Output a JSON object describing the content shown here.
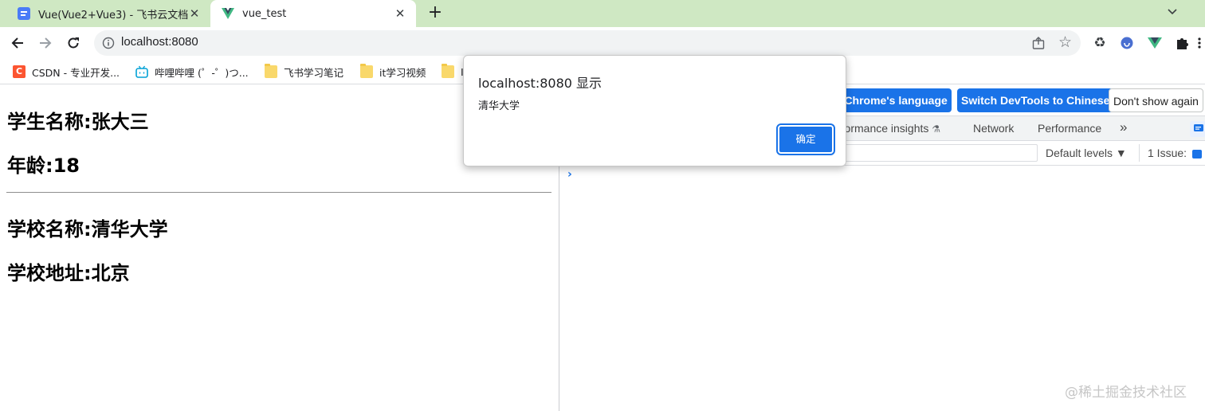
{
  "tabs": [
    {
      "title": "Vue(Vue2+Vue3) - 飞书云文档",
      "icon": "feishu-doc-icon"
    },
    {
      "title": "vue_test",
      "icon": "vue-logo-icon"
    }
  ],
  "address_bar": {
    "url": "localhost:8080"
  },
  "bookmarks": [
    {
      "label": "CSDN - 专业开发...",
      "icon": "csdn-icon"
    },
    {
      "label": "哔哩哔哩 (゜-゜)つ...",
      "icon": "bilibili-icon"
    },
    {
      "label": "飞书学习笔记",
      "icon": "folder-icon"
    },
    {
      "label": "it学习视频",
      "icon": "folder-icon"
    },
    {
      "label": "I",
      "icon": "folder-icon"
    }
  ],
  "page": {
    "student_name": "学生名称:张大三",
    "age": "年龄:18",
    "school_name": "学校名称:清华大学",
    "school_address": "学校地址:北京"
  },
  "devtools": {
    "infobar": {
      "match_language": "n Chrome's language",
      "switch_chinese": "Switch DevTools to Chinese",
      "dont_show": "Don't show again"
    },
    "tabs": [
      "rformance insights",
      "Network",
      "Performance"
    ],
    "console": {
      "levels": "Default levels ▼",
      "issues": "1 Issue:"
    }
  },
  "dialog": {
    "title": "localhost:8080 显示",
    "message": "清华大学",
    "ok_label": "确定"
  },
  "watermark": "@稀土掘金技术社区",
  "colors": {
    "tab_strip": "#cfe8c3",
    "accent": "#1a73e8",
    "vue_green": "#41b883"
  }
}
